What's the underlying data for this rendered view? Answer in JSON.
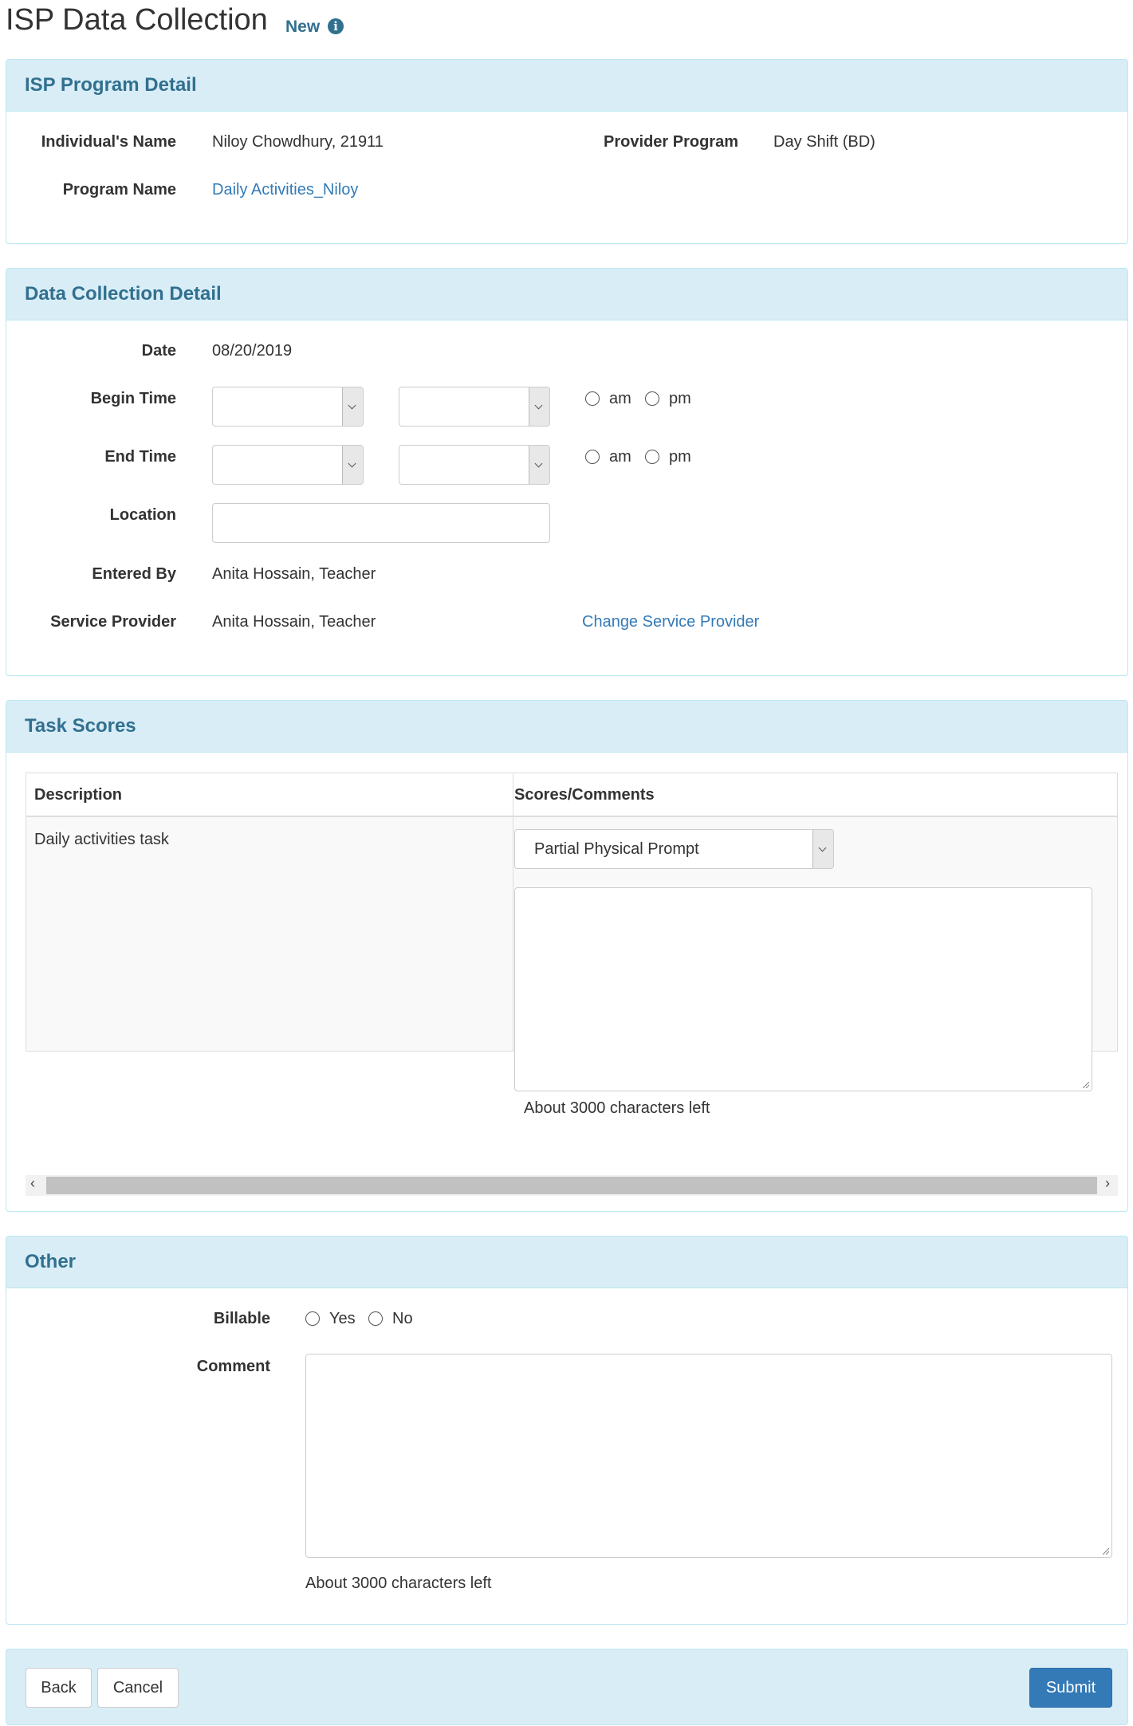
{
  "page": {
    "title": "ISP Data Collection",
    "badge": "New",
    "info_icon": "i"
  },
  "program_detail": {
    "heading": "ISP Program Detail",
    "individual_label": "Individual's Name",
    "individual_value": "Niloy Chowdhury, 21911",
    "provider_label": "Provider Program",
    "provider_value": "Day Shift (BD)",
    "program_label": "Program Name",
    "program_value": "Daily Activities_Niloy"
  },
  "collection_detail": {
    "heading": "Data Collection Detail",
    "date_label": "Date",
    "date_value": "08/20/2019",
    "begin_label": "Begin Time",
    "end_label": "End Time",
    "am": "am",
    "pm": "pm",
    "location_label": "Location",
    "location_value": "",
    "entered_label": "Entered By",
    "entered_value": "Anita Hossain, Teacher",
    "provider_label": "Service Provider",
    "provider_value": "Anita Hossain, Teacher",
    "change_link": "Change Service Provider"
  },
  "task_scores": {
    "heading": "Task Scores",
    "col_description": "Description",
    "col_scores": "Scores/Comments",
    "rows": [
      {
        "description": "Daily activities task",
        "score": "Partial Physical Prompt",
        "comment": "",
        "chars_left": "About 3000 characters left"
      }
    ]
  },
  "other": {
    "heading": "Other",
    "billable_label": "Billable",
    "yes": "Yes",
    "no": "No",
    "comment_label": "Comment",
    "comment_value": "",
    "chars_left": "About 3000 characters left"
  },
  "footer": {
    "back": "Back",
    "cancel": "Cancel",
    "submit": "Submit"
  },
  "colors": {
    "panel_head": "#d9edf7",
    "panel_title": "#31708f",
    "link": "#337ab7",
    "primary": "#337ab7"
  }
}
